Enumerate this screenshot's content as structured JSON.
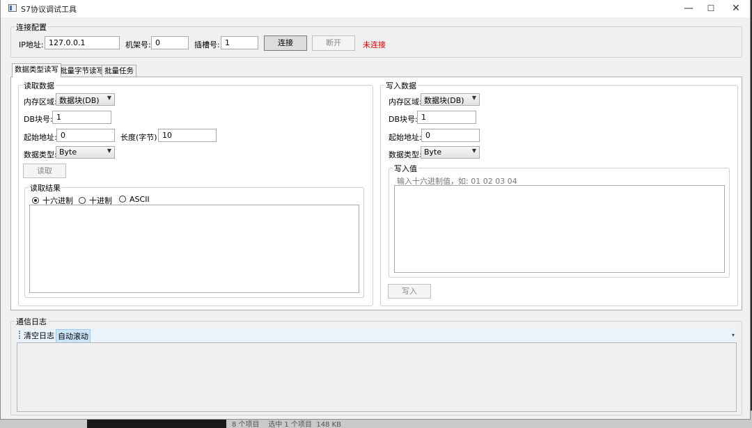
{
  "window": {
    "title": "S7协议调试工具",
    "controls": {
      "minimize": "—",
      "maximize": "☐",
      "close": "✕"
    }
  },
  "connection": {
    "group_label": "连接配置",
    "ip_label": "IP地址:",
    "ip_value": "127.0.0.1",
    "rack_label": "机架号:",
    "rack_value": "0",
    "slot_label": "插槽号:",
    "slot_value": "1",
    "connect_button": "连接",
    "disconnect_button": "断开",
    "status": "未连接",
    "status_color": "#e00000"
  },
  "tabs": [
    {
      "label": "数据类型读写",
      "active": true
    },
    {
      "label": "批量字节读写",
      "active": false
    },
    {
      "label": "批量任务",
      "active": false
    }
  ],
  "read": {
    "group_label": "读取数据",
    "memory_area_label": "内存区域:",
    "memory_area_value": "数据块(DB)",
    "db_label": "DB块号:",
    "db_value": "1",
    "start_label": "起始地址:",
    "start_value": "0",
    "length_label": "长度(字节):",
    "length_value": "10",
    "data_type_label": "数据类型:",
    "data_type_value": "Byte",
    "read_button": "读取",
    "result_group_label": "读取结果",
    "formats": [
      {
        "label": "十六进制",
        "checked": true
      },
      {
        "label": "十进制",
        "checked": false
      },
      {
        "label": "ASCII",
        "checked": false
      }
    ]
  },
  "write": {
    "group_label": "写入数据",
    "memory_area_label": "内存区域:",
    "memory_area_value": "数据块(DB)",
    "db_label": "DB块号:",
    "db_value": "1",
    "start_label": "起始地址:",
    "start_value": "0",
    "data_type_label": "数据类型:",
    "data_type_value": "Byte",
    "value_group_label": "写入值",
    "value_hint": "输入十六进制值，如: 01 02 03 04",
    "write_button": "写入"
  },
  "log": {
    "group_label": "通信日志",
    "clear_button": "清空日志",
    "auto_scroll": "自动滚动",
    "overflow_icon": "chevron-down-icon"
  },
  "desktop": {
    "status_text": "8 个项目    选中 1 个项目  148 KB"
  }
}
